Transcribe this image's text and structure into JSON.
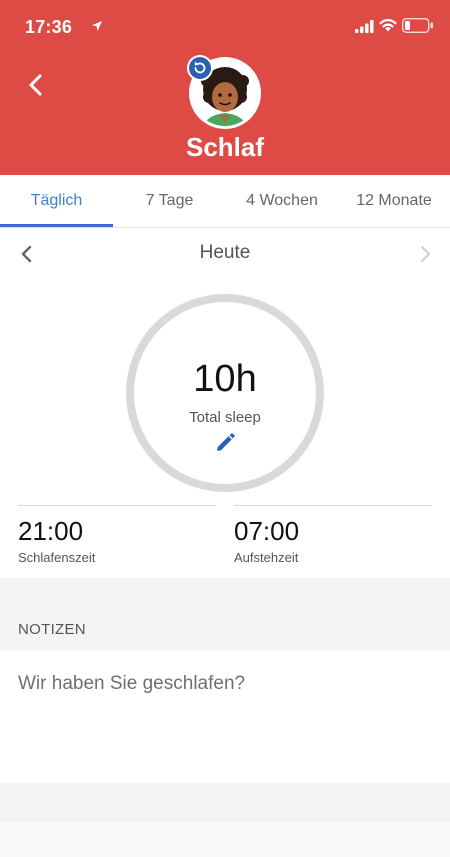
{
  "status_bar": {
    "time": "17:36"
  },
  "header": {
    "title": "Schlaf",
    "color": "#de4b45"
  },
  "tabs": [
    {
      "label": "Täglich",
      "active": true
    },
    {
      "label": "7 Tage",
      "active": false
    },
    {
      "label": "4 Wochen",
      "active": false
    },
    {
      "label": "12 Monate",
      "active": false
    }
  ],
  "day_nav": {
    "label": "Heute"
  },
  "summary": {
    "total_value": "10h",
    "total_label": "Total sleep"
  },
  "bedtime": {
    "value": "21:00",
    "label": "Schlafenszeit"
  },
  "wakeup": {
    "value": "07:00",
    "label": "Aufstehzeit"
  },
  "notes": {
    "heading": "NOTIZEN",
    "placeholder": "Wir haben Sie geschlafen?"
  },
  "icons": [
    "location-arrow-icon",
    "signal-icon",
    "wifi-icon",
    "battery-icon",
    "back-chevron-icon",
    "sync-icon",
    "avatar",
    "chevron-left-icon",
    "chevron-right-icon",
    "pencil-edit-icon"
  ]
}
